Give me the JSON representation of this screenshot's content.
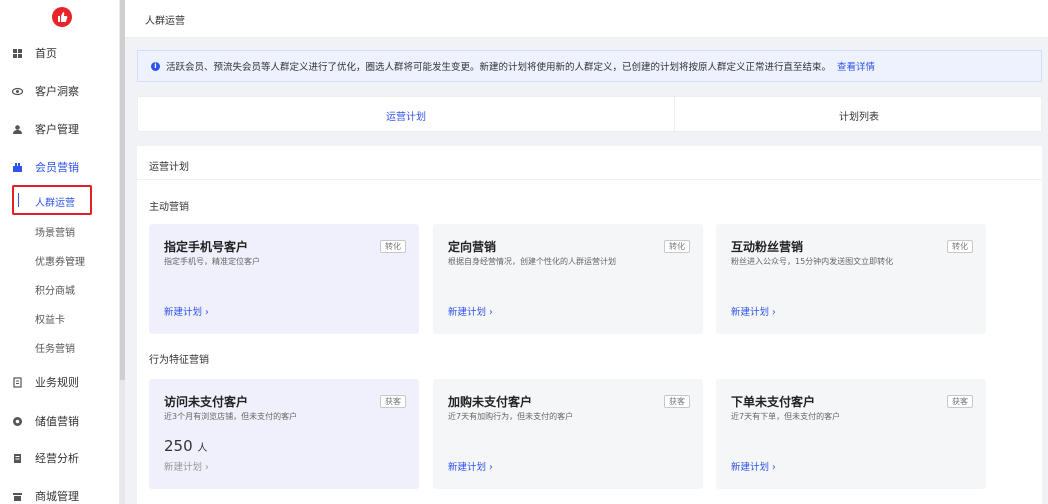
{
  "sidebar": {
    "items": [
      {
        "label": "首页",
        "icon": "dashboard-icon"
      },
      {
        "label": "客户洞察",
        "icon": "eye-icon"
      },
      {
        "label": "客户管理",
        "icon": "user-icon"
      },
      {
        "label": "会员营销",
        "icon": "members-icon"
      }
    ],
    "sub_items": [
      {
        "label": "人群运营"
      },
      {
        "label": "场景营销"
      },
      {
        "label": "优惠券管理"
      },
      {
        "label": "积分商城"
      },
      {
        "label": "权益卡"
      },
      {
        "label": "任务营销"
      }
    ],
    "bottom_items": [
      {
        "label": "业务规则",
        "icon": "rules-icon"
      },
      {
        "label": "储值营销",
        "icon": "stored-value-icon"
      },
      {
        "label": "经营分析",
        "icon": "analysis-icon"
      },
      {
        "label": "商城管理",
        "icon": "store-icon"
      }
    ]
  },
  "topbar": {
    "breadcrumb": "人群运营"
  },
  "notice": {
    "text": "活跃会员、预流失会员等人群定义进行了优化，圈选人群将可能发生变更。新建的计划将使用新的人群定义，已创建的计划将按原人群定义正常进行直至结束。",
    "link": "查看详情"
  },
  "tabs": [
    {
      "label": "运营计划"
    },
    {
      "label": "计划列表"
    }
  ],
  "panel": {
    "title": "运营计划",
    "sections": [
      {
        "title": "主动营销",
        "cards": [
          {
            "title": "指定手机号客户",
            "desc": "指定手机号，精准定位客户",
            "tag": "转化",
            "link": "新建计划 ›"
          },
          {
            "title": "定向营销",
            "desc": "根据自身经营情况，创建个性化的人群运营计划",
            "tag": "转化",
            "link": "新建计划 ›"
          },
          {
            "title": "互动粉丝营销",
            "desc": "粉丝进入公众号，15分钟内发送图文立即转化",
            "tag": "转化",
            "link": "新建计划 ›"
          }
        ]
      },
      {
        "title": "行为特征营销",
        "cards": [
          {
            "title": "访问未支付客户",
            "desc": "近3个月有浏览店铺，但未支付的客户",
            "tag": "获客",
            "count": "250",
            "unit": "人",
            "link": "新建计划 ›"
          },
          {
            "title": "加购未支付客户",
            "desc": "近7天有加购行为，但未支付的客户",
            "tag": "获客",
            "link": "新建计划 ›"
          },
          {
            "title": "下单未支付客户",
            "desc": "近7天有下单，但未支付的客户",
            "tag": "获客",
            "link": "新建计划 ›"
          }
        ]
      }
    ]
  },
  "colors": {
    "accent": "#2f54eb",
    "highlight": "#e02020"
  }
}
